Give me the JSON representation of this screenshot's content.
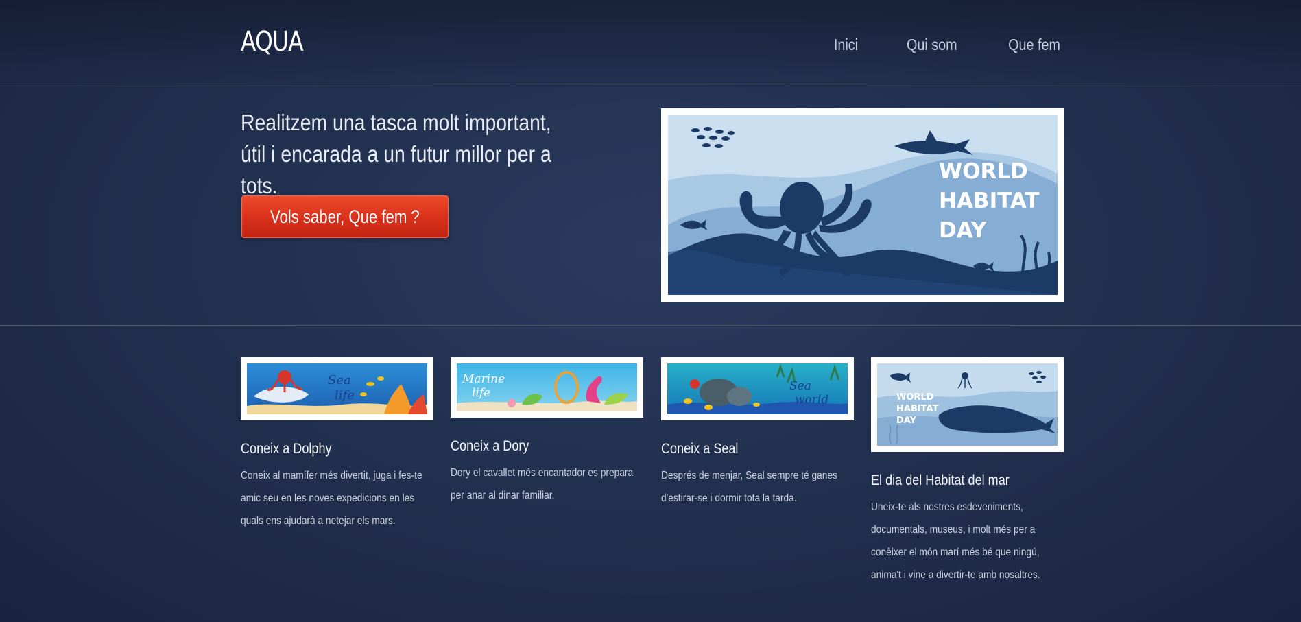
{
  "header": {
    "logo": "AQUA",
    "nav": [
      {
        "label": "Inici"
      },
      {
        "label": "Qui som"
      },
      {
        "label": "Que fem"
      }
    ]
  },
  "hero": {
    "headline": "Realitzem una tasca molt important, útil i encarada a un futur millor per a tots.",
    "cta_label": "Vols saber, Que fem ?",
    "image": {
      "text_lines": [
        "WORLD",
        "HABITAT",
        "DAY"
      ]
    }
  },
  "cards": [
    {
      "title": "Coneix a Dolphy",
      "text": "Coneix al mamífer més divertit, juga i fes-te amic seu en les noves expedicions en les quals ens ajudarà a netejar els mars.",
      "image_text": [
        "Sea",
        "life"
      ]
    },
    {
      "title": "Coneix a Dory",
      "text": "Dory el cavallet més encantador es prepara per anar al dinar familiar.",
      "image_text": [
        "Marine",
        "life"
      ]
    },
    {
      "title": "Coneix a Seal",
      "text": "Després de menjar, Seal sempre té ganes d'estirar-se i dormir tota la tarda.",
      "image_text": [
        "Sea",
        "world"
      ]
    },
    {
      "title": "El dia del Habitat del mar",
      "text": "Uneix-te als nostres esdeveniments, documentals, museus, i molt més per a conèixer el món marí més bé que ningú, anima't i vine a divertir-te amb nosaltres.",
      "image_text": [
        "WORLD",
        "HABITAT",
        "DAY"
      ]
    }
  ],
  "colors": {
    "background": "#22304f",
    "cta": "#d8301b",
    "ocean_dark": "#1b3a66",
    "ocean_light": "#b7d2ea"
  }
}
